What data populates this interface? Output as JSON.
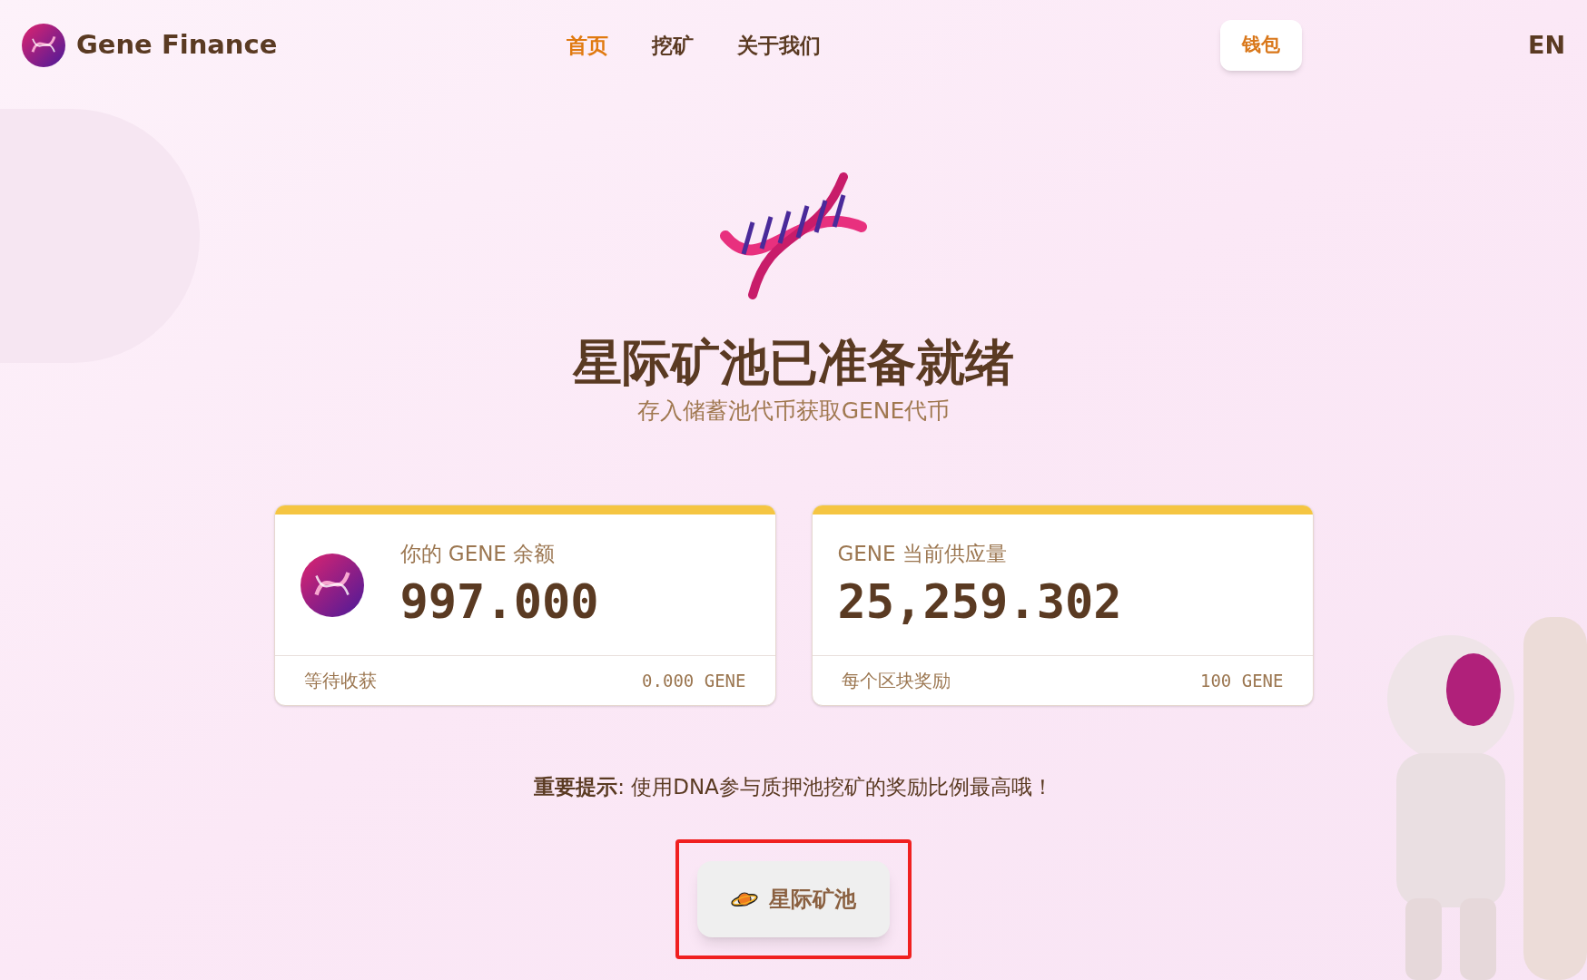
{
  "brand": {
    "name": "Gene Finance"
  },
  "nav": [
    {
      "label": "首页",
      "selected": true
    },
    {
      "label": "挖矿",
      "selected": false
    },
    {
      "label": "关于我们",
      "selected": false
    }
  ],
  "wallet_button": "钱包",
  "language": "EN",
  "hero": {
    "title": "星际矿池已准备就绪",
    "subtitle": "存入储蓄池代币获取GENE代币"
  },
  "cards": [
    {
      "kind": "balance",
      "label": "你的 GENE 余额",
      "value": "997.000",
      "footer_label": "等待收获",
      "footer_value": "0.000 GENE"
    },
    {
      "kind": "supply",
      "label": "GENE 当前供应量",
      "value": "25,259.302",
      "footer_label": "每个区块奖励",
      "footer_value": "100 GENE"
    }
  ],
  "notice": "**重要提示**: 使用DNA参与质押池挖矿的奖励比例最高哦！",
  "pool_button": {
    "label": "星际矿池",
    "highlighted": true
  }
}
